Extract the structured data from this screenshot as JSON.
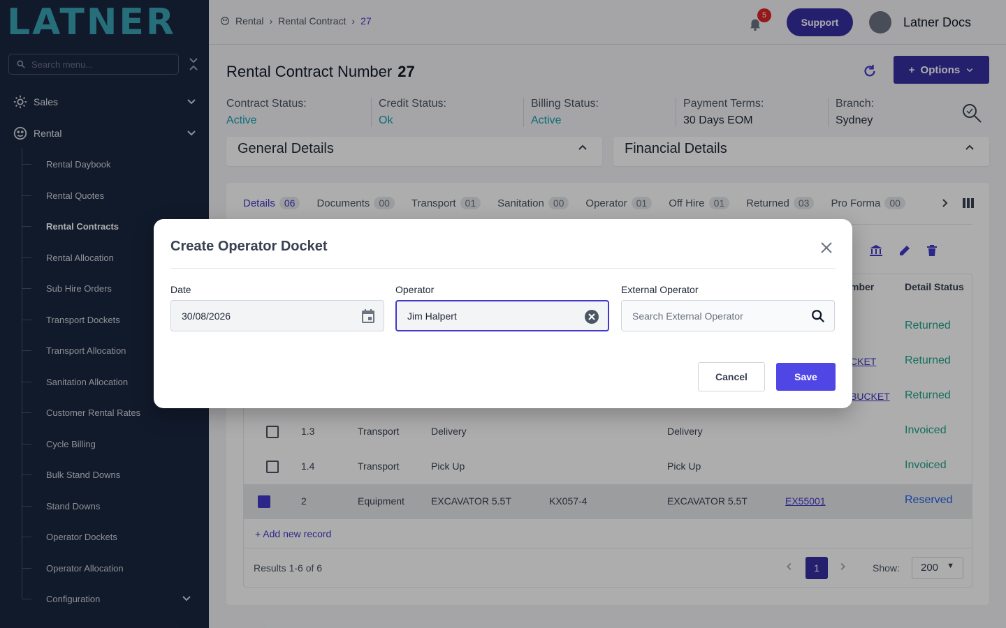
{
  "sidebar": {
    "logo": "LATNER",
    "search_placeholder": "Search menu...",
    "sections": [
      {
        "label": "Sales"
      },
      {
        "label": "Rental"
      }
    ],
    "items": [
      {
        "label": "Rental Daybook"
      },
      {
        "label": "Rental Quotes"
      },
      {
        "label": "Rental Contracts"
      },
      {
        "label": "Rental Allocation"
      },
      {
        "label": "Sub Hire Orders"
      },
      {
        "label": "Transport Dockets"
      },
      {
        "label": "Transport Allocation"
      },
      {
        "label": "Sanitation Allocation"
      },
      {
        "label": "Customer Rental Rates"
      },
      {
        "label": "Cycle Billing"
      },
      {
        "label": "Bulk Stand Downs"
      },
      {
        "label": "Stand Downs"
      },
      {
        "label": "Operator Dockets"
      },
      {
        "label": "Operator Allocation"
      },
      {
        "label": "Configuration"
      }
    ],
    "active_item": "Rental Contracts"
  },
  "topbar": {
    "breadcrumb": [
      "Rental",
      "Rental Contract",
      "27"
    ],
    "notification_count": "5",
    "support_label": "Support",
    "user_name": "Latner Docs"
  },
  "header": {
    "title": "Rental Contract Number",
    "number": "27",
    "options_label": "Options",
    "statuses": [
      {
        "key": "Contract Status:",
        "value": "Active"
      },
      {
        "key": "Credit Status:",
        "value": "Ok"
      },
      {
        "key": "Billing Status:",
        "value": "Active"
      },
      {
        "key": "Payment Terms:",
        "value": "30 Days EOM"
      },
      {
        "key": "Branch:",
        "value": "Sydney"
      }
    ]
  },
  "cards": {
    "general": "General Details",
    "financial": "Financial Details"
  },
  "tabs": [
    {
      "label": "Details",
      "count": "06"
    },
    {
      "label": "Documents",
      "count": "00"
    },
    {
      "label": "Transport",
      "count": "01"
    },
    {
      "label": "Sanitation",
      "count": "00"
    },
    {
      "label": "Operator",
      "count": "01"
    },
    {
      "label": "Off Hire",
      "count": "01"
    },
    {
      "label": "Returned",
      "count": "03"
    },
    {
      "label": "Pro Forma",
      "count": "00"
    }
  ],
  "table": {
    "headers": {
      "number": "mber",
      "status": "Detail Status"
    },
    "rows": [
      {
        "status": "Returned"
      },
      {
        "link": "CKET",
        "status": "Returned"
      },
      {
        "link": "BUCKET",
        "status": "Returned"
      },
      {
        "line": "1.3",
        "type": "Transport",
        "item": "Delivery",
        "desc": "Delivery",
        "status": "Invoiced"
      },
      {
        "line": "1.4",
        "type": "Transport",
        "item": "Pick Up",
        "desc": "Pick Up",
        "status": "Invoiced"
      },
      {
        "line": "2",
        "type": "Equipment",
        "item": "EXCAVATOR 5.5T",
        "code": "KX057-4",
        "desc": "EXCAVATOR 5.5T",
        "link": "EX55001",
        "status": "Reserved"
      }
    ],
    "add_record": "+ Add new record",
    "results": "Results 1-6 of 6",
    "current_page": "1",
    "show_label": "Show:",
    "page_size": "200"
  },
  "modal": {
    "title": "Create Operator Docket",
    "date_label": "Date",
    "date_value": "30/08/2026",
    "operator_label": "Operator",
    "operator_value": "Jim Halpert",
    "external_label": "External Operator",
    "external_placeholder": "Search External Operator",
    "cancel_label": "Cancel",
    "save_label": "Save"
  },
  "colors": {
    "sidebar_bg": "#1a2740",
    "accent": "#4338ca",
    "teal": "#14a0b4",
    "status_green": "#22a38a"
  }
}
